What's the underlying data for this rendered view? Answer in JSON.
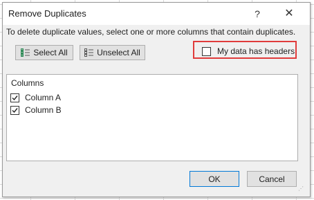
{
  "dialog": {
    "title": "Remove Duplicates",
    "help_label": "?",
    "close_label": "✕",
    "instructions": "To delete duplicate values, select one or more columns that contain duplicates."
  },
  "toolbar": {
    "select_all_label": "Select All",
    "select_all_icon": "select-all-icon",
    "unselect_all_label": "Unselect All",
    "unselect_all_icon": "unselect-all-icon"
  },
  "headers_option": {
    "label": "My data has headers",
    "checked": false,
    "highlight_color": "#e03b3b"
  },
  "columns": {
    "header": "Columns",
    "items": [
      {
        "label": "Column A",
        "checked": true
      },
      {
        "label": "Column B",
        "checked": true
      }
    ]
  },
  "actions": {
    "ok_label": "OK",
    "cancel_label": "Cancel"
  }
}
